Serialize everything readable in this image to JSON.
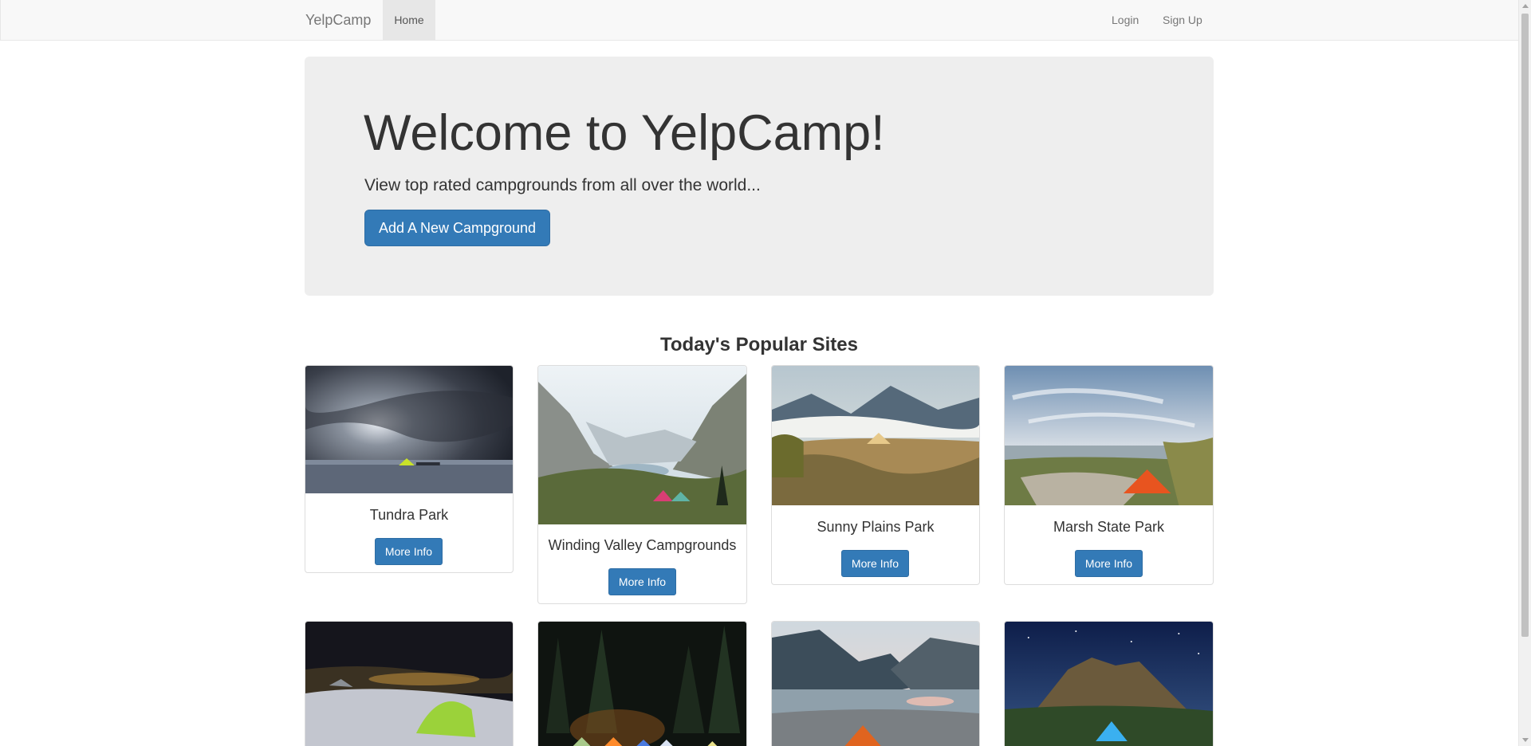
{
  "navbar": {
    "brand": "YelpCamp",
    "home": "Home",
    "login": "Login",
    "signup": "Sign Up"
  },
  "jumbotron": {
    "title": "Welcome to YelpCamp!",
    "subtitle": "View top rated campgrounds from all over the world...",
    "button": "Add A New Campground"
  },
  "section_title": "Today's Popular Sites",
  "campgrounds": [
    {
      "name": "Tundra Park",
      "button": "More Info"
    },
    {
      "name": "Winding Valley Campgrounds",
      "button": "More Info"
    },
    {
      "name": "Sunny Plains Park",
      "button": "More Info"
    },
    {
      "name": "Marsh State Park",
      "button": "More Info"
    }
  ],
  "colors": {
    "primary": "#337ab7",
    "navbar_bg": "#f8f8f8",
    "jumbotron_bg": "#eeeeee"
  }
}
